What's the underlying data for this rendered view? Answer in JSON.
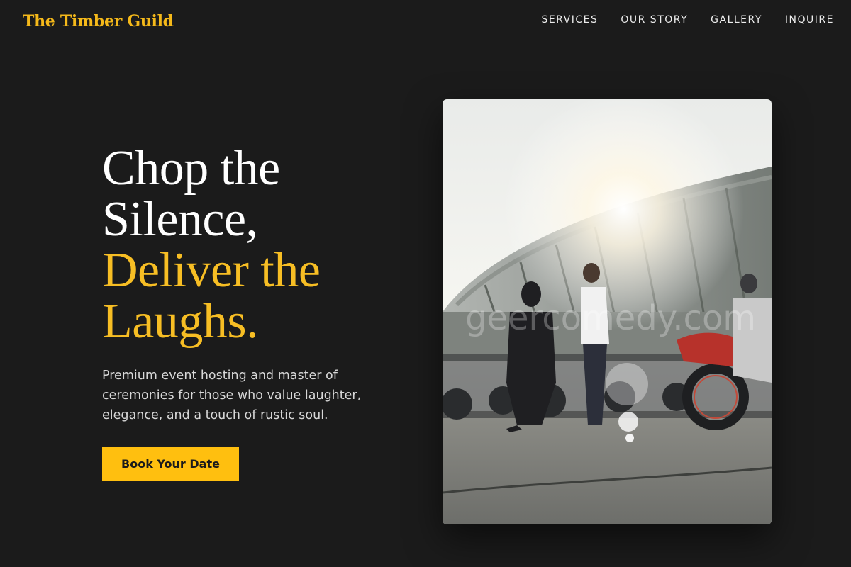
{
  "header": {
    "logo": "The Timber Guild",
    "nav": [
      {
        "label": "SERVICES"
      },
      {
        "label": "OUR STORY"
      },
      {
        "label": "GALLERY"
      },
      {
        "label": "INQUIRE"
      }
    ]
  },
  "hero": {
    "headline": {
      "line1": "Chop the",
      "line2": "Silence,",
      "line3": "Deliver the",
      "line4": "Laughs."
    },
    "subtext": "Premium event hosting and master of ceremonies for those who value laughter, elegance, and a touch of rustic soul.",
    "cta_label": "Book Your Date",
    "image_watermark": "geercomedy.com"
  },
  "colors": {
    "background": "#1b1b1b",
    "accent": "#f7be24",
    "button": "#ffbf0f"
  }
}
